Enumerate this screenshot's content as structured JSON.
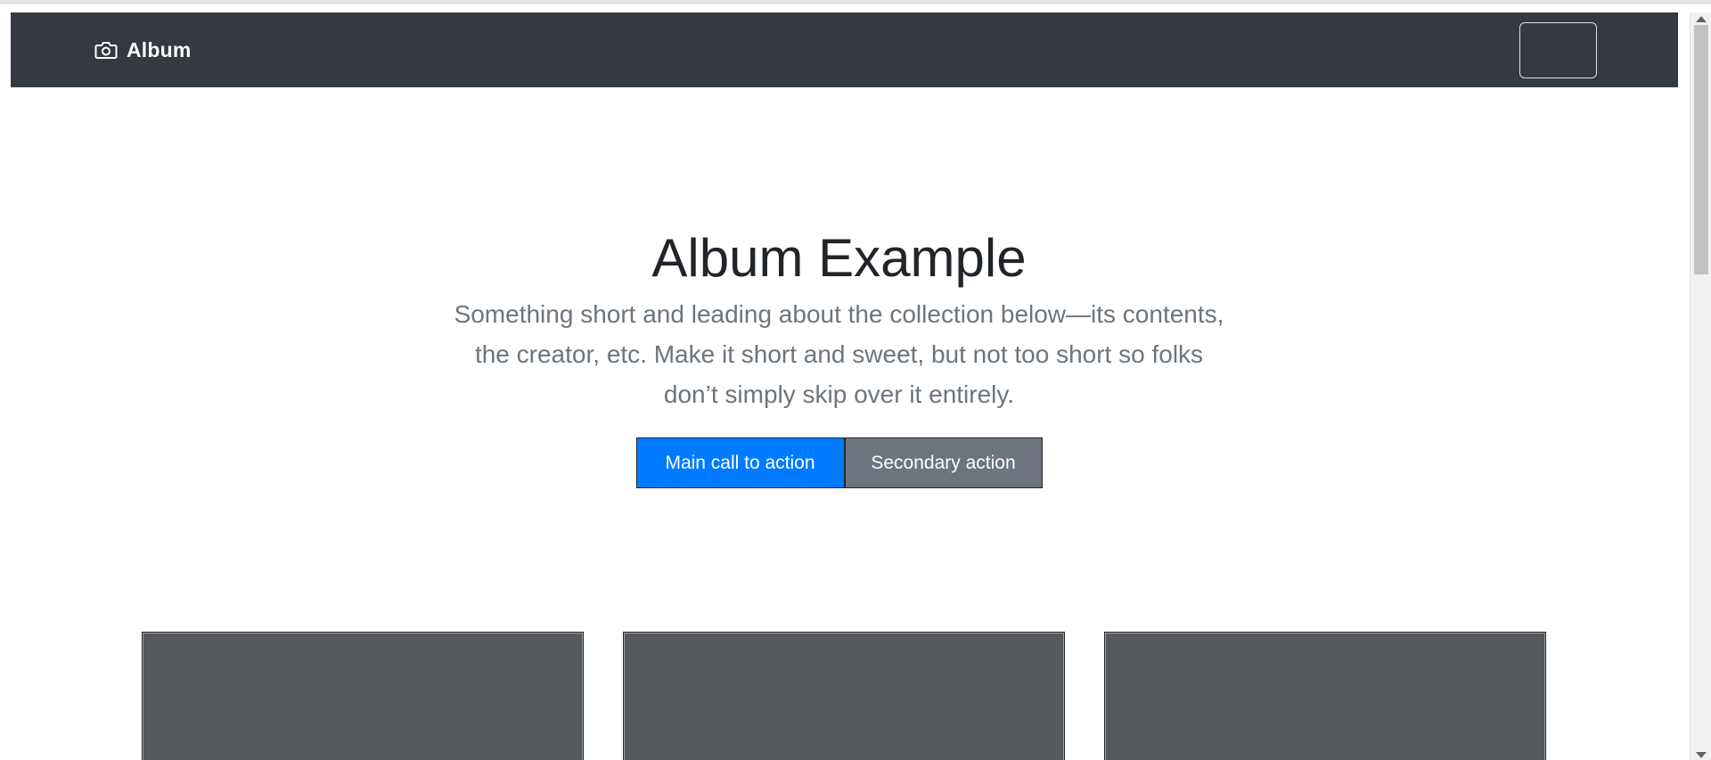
{
  "navbar": {
    "brand_label": "Album",
    "brand_icon": "camera-icon",
    "background": "#343a40"
  },
  "hero": {
    "title": "Album Example",
    "lead": "Something short and leading about the collection below—its contents, the creator, etc. Make it short and sweet, but not too short so folks don’t simply skip over it entirely.",
    "primary_button": "Main call to action",
    "secondary_button": "Secondary action"
  },
  "colors": {
    "primary": "#007bff",
    "secondary": "#6c757d",
    "card_placeholder": "#55595c"
  },
  "cards": {
    "count_visible": 3
  }
}
